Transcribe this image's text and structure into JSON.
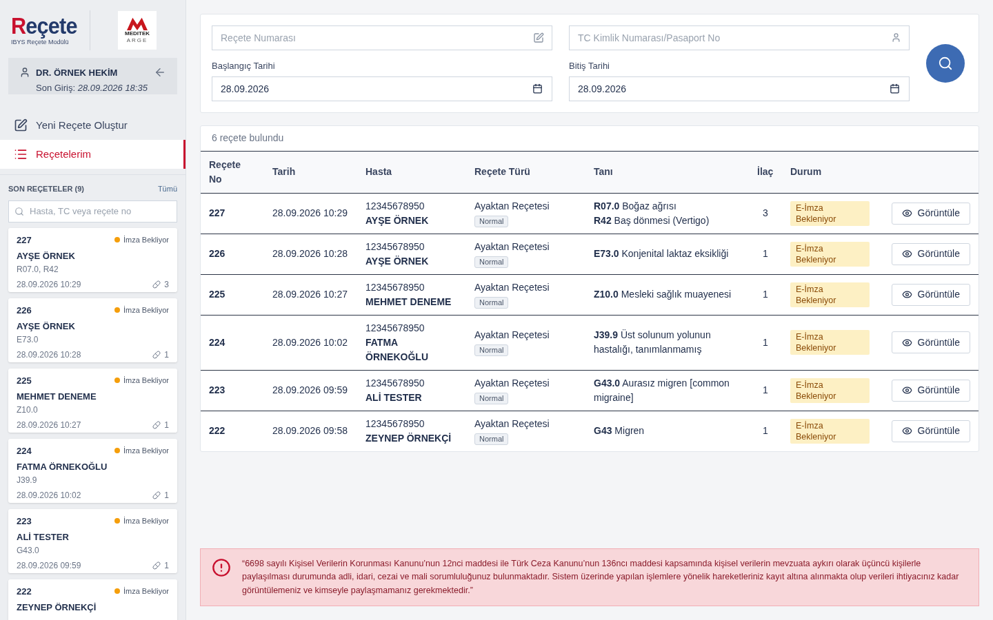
{
  "brand": {
    "logo": "Reçete",
    "subtitle": "IBYS Reçete Modülü",
    "partner_logo": "MEDITEK",
    "partner_sub": "ARGE"
  },
  "user": {
    "name": "DR. ÖRNEK HEKİM",
    "last_login_label": "Son Giriş:",
    "last_login": "28.09.2026 18:35"
  },
  "nav": [
    {
      "label": "Yeni Reçete Oluştur",
      "kind": "edit",
      "selected": false
    },
    {
      "label": "Reçetelerim",
      "kind": "list",
      "selected": true
    }
  ],
  "recent": {
    "title": "SON REÇETELER (9)",
    "all_link": "Tümü",
    "search_placeholder": "Hasta, TC veya reçete no",
    "items": [
      {
        "no": "227",
        "status": "İmza Bekliyor",
        "color": "#f59e0b",
        "name": "AYŞE ÖRNEK",
        "codes": "R07.0, R42",
        "date": "28.09.2026 10:29",
        "count": "3"
      },
      {
        "no": "226",
        "status": "İmza Bekliyor",
        "color": "#f59e0b",
        "name": "AYŞE ÖRNEK",
        "codes": "E73.0",
        "date": "28.09.2026 10:28",
        "count": "1"
      },
      {
        "no": "225",
        "status": "İmza Bekliyor",
        "color": "#f59e0b",
        "name": "MEHMET DENEME",
        "codes": "Z10.0",
        "date": "28.09.2026 10:27",
        "count": "1"
      },
      {
        "no": "224",
        "status": "İmza Bekliyor",
        "color": "#f59e0b",
        "name": "FATMA ÖRNEKOĞLU",
        "codes": "J39.9",
        "date": "28.09.2026 10:02",
        "count": "1"
      },
      {
        "no": "223",
        "status": "İmza Bekliyor",
        "color": "#f59e0b",
        "name": "ALİ TESTER",
        "codes": "G43.0",
        "date": "28.09.2026 09:59",
        "count": "1"
      },
      {
        "no": "222",
        "status": "İmza Bekliyor",
        "color": "#f59e0b",
        "name": "ZEYNEP ÖRNEKÇİ"
      }
    ]
  },
  "filters": {
    "prescription_placeholder": "Reçete Numarası",
    "id_placeholder": "TC Kimlik Numarası/Pasaport No",
    "start_label": "Başlangıç Tarihi",
    "start_value": "28.09.2026",
    "end_label": "Bitiş Tarihi",
    "end_value": "28.09.2026"
  },
  "results": {
    "count_text": "6 reçete bulundu",
    "columns": [
      "Reçete No",
      "Tarih",
      "Hasta",
      "Reçete Türü",
      "Tanı",
      "İlaç",
      "Durum"
    ],
    "rows": [
      {
        "no": "227",
        "date": "28.09.2026 10:29",
        "tc": "12345678950",
        "patient": "AYŞE ÖRNEK",
        "type": "Ayaktan Reçetesi",
        "badge": "Normal",
        "diagnoses": [
          "**R07.0** Boğaz ağrısı",
          "**R42** Baş dönmesi (Vertigo)"
        ],
        "drugs": "3",
        "status": "E-İmza Bekleniyor",
        "action": "Görüntüle"
      },
      {
        "no": "226",
        "date": "28.09.2026 10:28",
        "tc": "12345678950",
        "patient": "AYŞE ÖRNEK",
        "type": "Ayaktan Reçetesi",
        "badge": "Normal",
        "diagnoses": [
          "**E73.0** Konjenital laktaz eksikliği"
        ],
        "drugs": "1",
        "status": "E-İmza Bekleniyor",
        "action": "Görüntüle"
      },
      {
        "no": "225",
        "date": "28.09.2026 10:27",
        "tc": "12345678950",
        "patient": "MEHMET DENEME",
        "type": "Ayaktan Reçetesi",
        "badge": "Normal",
        "diagnoses": [
          "**Z10.0** Mesleki sağlık muayenesi"
        ],
        "drugs": "1",
        "status": "E-İmza Bekleniyor",
        "action": "Görüntüle"
      },
      {
        "no": "224",
        "date": "28.09.2026 10:02",
        "tc": "12345678950",
        "patient": "FATMA ÖRNEKOĞLU",
        "type": "Ayaktan Reçetesi",
        "badge": "Normal",
        "diagnoses": [
          "**J39.9** Üst solunum yolunun hastalığı, tanımlanmamış"
        ],
        "drugs": "1",
        "status": "E-İmza Bekleniyor",
        "action": "Görüntüle"
      },
      {
        "no": "223",
        "date": "28.09.2026 09:59",
        "tc": "12345678950",
        "patient": "ALİ TESTER",
        "type": "Ayaktan Reçetesi",
        "badge": "Normal",
        "diagnoses": [
          "**G43.0** Aurasız migren [common migraine]"
        ],
        "drugs": "1",
        "status": "E-İmza Bekleniyor",
        "action": "Görüntüle"
      },
      {
        "no": "222",
        "date": "28.09.2026 09:58",
        "tc": "12345678950",
        "patient": "ZEYNEP ÖRNEKÇİ",
        "type": "Ayaktan Reçetesi",
        "badge": "Normal",
        "diagnoses": [
          "**G43** Migren"
        ],
        "drugs": "1",
        "status": "E-İmza Bekleniyor",
        "action": "Görüntüle"
      }
    ]
  },
  "warning": "“6698 sayılı Kişisel Verilerin Korunması Kanunu’nun 12nci maddesi ile Türk Ceza Kanunu’nun 136ncı maddesi kapsamında kişisel verilerin mevzuata aykırı olarak üçüncü kişilerle paylaşılması durumunda adli, idari, cezai ve mali sorumluluğunuz bulunmaktadır. Sistem üzerinde yapılan işlemlere yönelik hareketleriniz kayıt altına alınmakta olup verileri ihtiyacınız kadar görüntülemeniz ve kimseyle paylaşmamanız gerekmektedir.”"
}
